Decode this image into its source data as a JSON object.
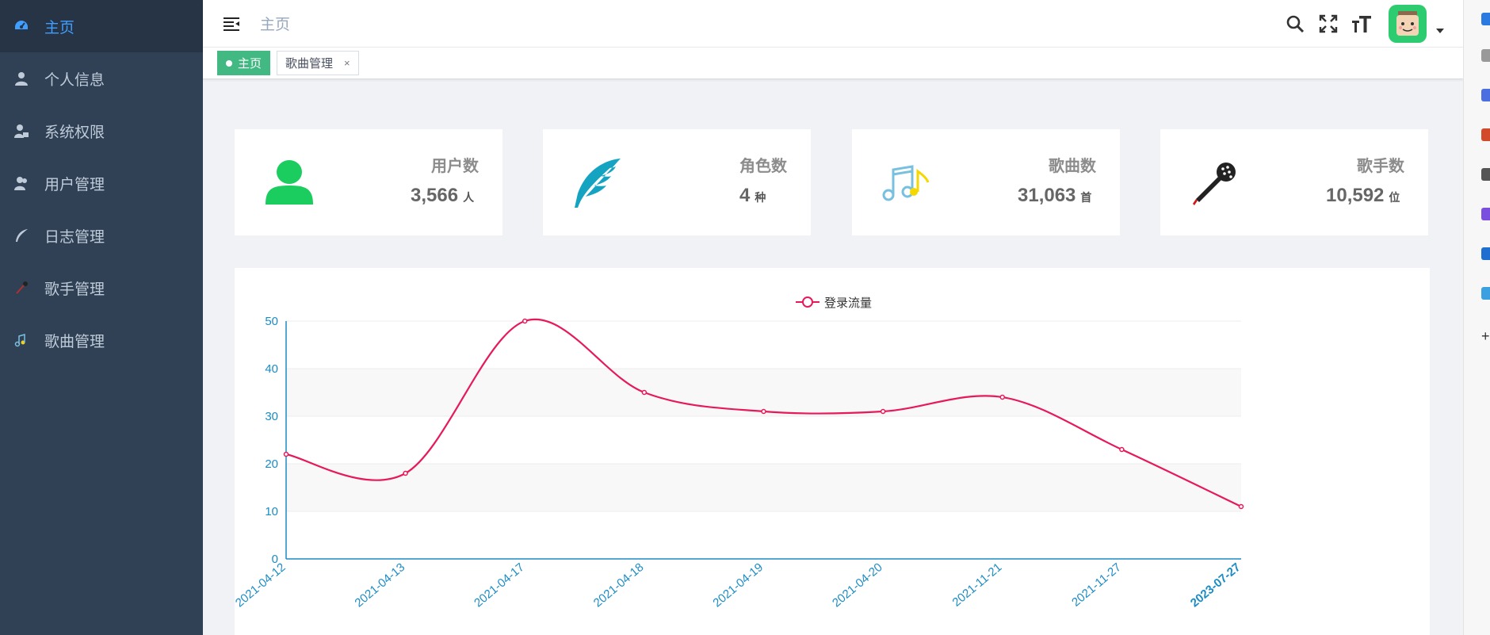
{
  "sidebar": {
    "items": [
      {
        "label": "主页",
        "icon": "dashboard-icon",
        "active": true
      },
      {
        "label": "个人信息",
        "icon": "user-icon"
      },
      {
        "label": "系统权限",
        "icon": "user-lock-icon"
      },
      {
        "label": "用户管理",
        "icon": "users-icon"
      },
      {
        "label": "日志管理",
        "icon": "feather-icon"
      },
      {
        "label": "歌手管理",
        "icon": "microphone-icon"
      },
      {
        "label": "歌曲管理",
        "icon": "music-icon"
      }
    ]
  },
  "navbar": {
    "breadcrumb": "主页",
    "icons": [
      "search-icon",
      "fullscreen-icon",
      "font-size-icon"
    ]
  },
  "tags": [
    {
      "label": "主页",
      "active": true
    },
    {
      "label": "歌曲管理",
      "close": "×"
    }
  ],
  "stats": [
    {
      "label": "用户数",
      "value": "3,566",
      "unit": "人",
      "icon": "user-icon",
      "color": "#1bcc5f"
    },
    {
      "label": "角色数",
      "value": "4",
      "unit": "种",
      "icon": "feather-icon",
      "color": "#14a3c0"
    },
    {
      "label": "歌曲数",
      "value": "31,063",
      "unit": "首",
      "icon": "music-notes-icon",
      "color": "#78c0e0"
    },
    {
      "label": "歌手数",
      "value": "10,592",
      "unit": "位",
      "icon": "microphone-icon",
      "color": "#222222"
    }
  ],
  "chart_data": {
    "type": "line",
    "legend": "登录流量",
    "categories": [
      "2021-04-12",
      "2021-04-13",
      "2021-04-17",
      "2021-04-18",
      "2021-04-19",
      "2021-04-20",
      "2021-11-21",
      "2021-11-27",
      "2023-07-27"
    ],
    "values": [
      22,
      18,
      50,
      35,
      31,
      31,
      34,
      23,
      11
    ],
    "ylim": [
      0,
      50
    ],
    "yticks": [
      0,
      10,
      20,
      30,
      40,
      50
    ],
    "smooth": true,
    "line_color": "#e6195a",
    "axis_color": "#1b8cc4",
    "legend_position": "top-center"
  }
}
